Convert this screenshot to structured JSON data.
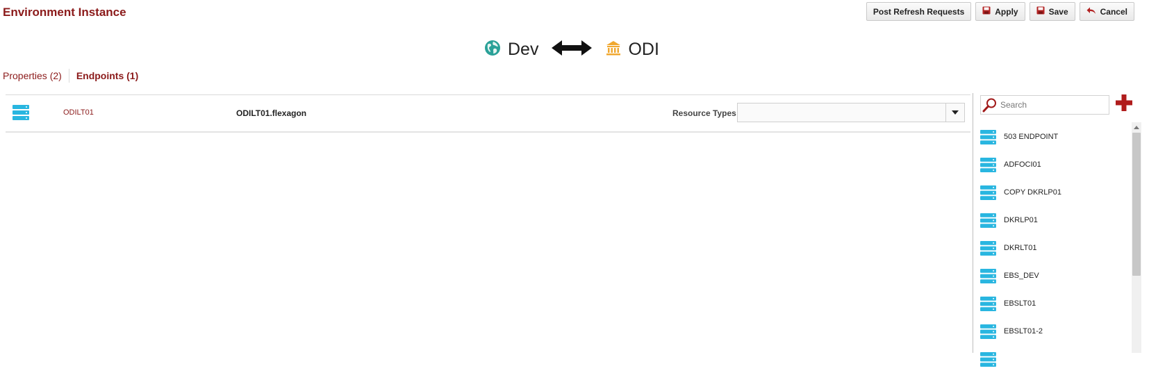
{
  "page": {
    "title": "Environment Instance"
  },
  "toolbar": {
    "post_refresh_label": "Post Refresh Requests",
    "apply_label": "Apply",
    "save_label": "Save",
    "cancel_label": "Cancel"
  },
  "env_header": {
    "environment": "Dev",
    "environment_icon": "globe-icon",
    "instance": "ODI",
    "instance_icon": "building-icon"
  },
  "tabs": [
    {
      "label": "Properties (2)",
      "active": false
    },
    {
      "label": "Endpoints (1)",
      "active": true
    }
  ],
  "endpoint": {
    "name": "ODILT01",
    "host": "ODILT01.flexagon",
    "resource_types_label": "Resource Types",
    "resource_types_value": ""
  },
  "side_panel": {
    "search_placeholder": "Search",
    "items": [
      {
        "label": "503 ENDPOINT"
      },
      {
        "label": "ADFOCI01"
      },
      {
        "label": "COPY DKRLP01"
      },
      {
        "label": "DKRLP01"
      },
      {
        "label": "DKRLT01"
      },
      {
        "label": "EBS_DEV"
      },
      {
        "label": "EBSLT01"
      },
      {
        "label": "EBSLT01-2"
      },
      {
        "label": ""
      }
    ]
  },
  "colors": {
    "title": "#8b1a1a",
    "endpoint_icon": "#29b6e0",
    "globe": "#2aa198",
    "building": "#f0a830",
    "add": "#b01c1c"
  }
}
